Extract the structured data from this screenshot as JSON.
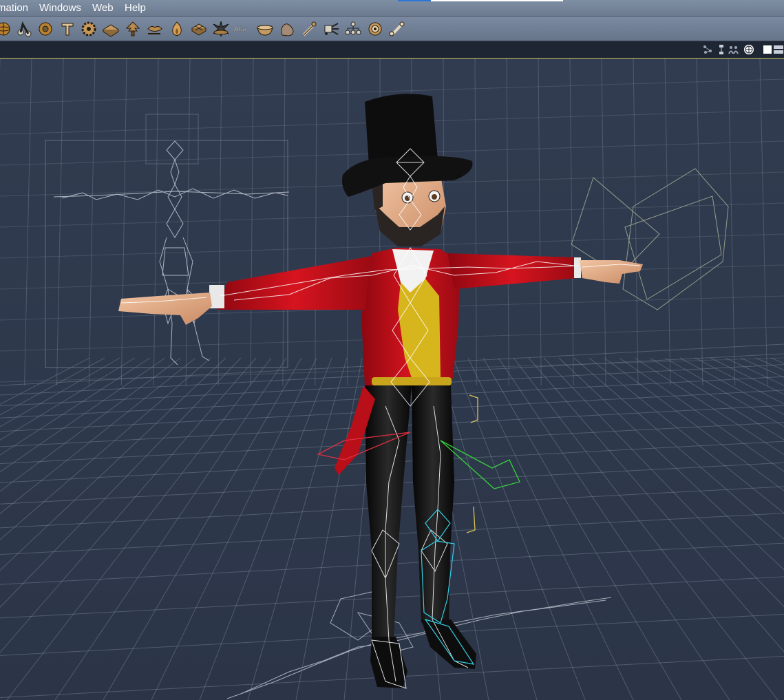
{
  "menubar": {
    "items": [
      {
        "label": "mation"
      },
      {
        "label": "Windows"
      },
      {
        "label": "Web"
      },
      {
        "label": "Help"
      }
    ],
    "progress_fraction": 0.2
  },
  "toolbar": {
    "tools": [
      {
        "icon": "sphere-icon"
      },
      {
        "icon": "bend-icon"
      },
      {
        "icon": "rotate-icon"
      },
      {
        "icon": "text-tool-icon"
      },
      {
        "icon": "gear-icon"
      },
      {
        "icon": "plane-icon"
      },
      {
        "icon": "tree-icon"
      },
      {
        "icon": "lips-icon"
      },
      {
        "icon": "flame-icon"
      },
      {
        "icon": "grid-box-icon"
      },
      {
        "icon": "starburst-icon"
      },
      {
        "icon": "agent-icon",
        "label": "AGr"
      },
      {
        "icon": "bowl-icon"
      },
      {
        "icon": "hand-icon"
      },
      {
        "icon": "wand-icon"
      },
      {
        "icon": "particles-icon"
      },
      {
        "icon": "hierarchy-icon"
      },
      {
        "icon": "target-icon"
      },
      {
        "icon": "bone-icon"
      }
    ]
  },
  "view_controls": {
    "icons": [
      "network-icon",
      "tree-view-icon",
      "figures-icon",
      "render-sphere-icon",
      "single-view-icon",
      "split-view-icon"
    ]
  },
  "colors": {
    "viewport_bg": "#2a3446",
    "grid_line": "#8a96a8",
    "coat": "#c0111b",
    "vest": "#d7b51c",
    "trousers": "#141414",
    "hat": "#0d0d0d",
    "skin": "#e7b08d",
    "selection": "#d4c45a"
  }
}
